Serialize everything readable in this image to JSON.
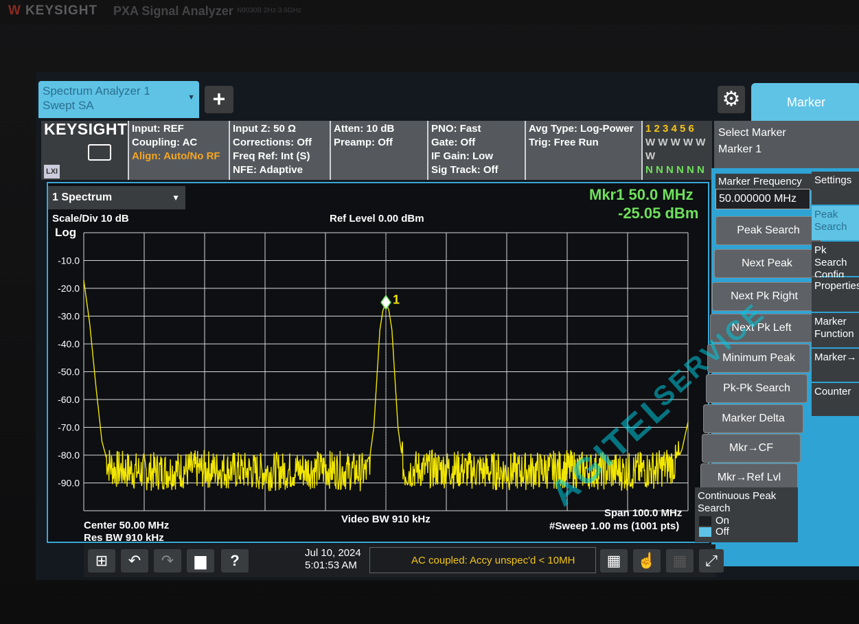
{
  "bezel": {
    "brand": "KEYSIGHT",
    "model": "PXA Signal Analyzer",
    "sub": "N9030B  2Hz-3.6GHz"
  },
  "tabs": {
    "active_line1": "Spectrum Analyzer 1",
    "active_line2": "Swept SA",
    "add": "+"
  },
  "right_tab": {
    "label": "Marker"
  },
  "info": {
    "brand": "KEYSIGHT",
    "lxi": "LXI",
    "col1": [
      "Input: REF",
      "Coupling: AC",
      "Align: Auto/No RF"
    ],
    "col2": [
      "Input Z: 50 Ω",
      "Corrections: Off",
      "Freq Ref: Int (S)",
      "NFE: Adaptive"
    ],
    "col3": [
      "Atten: 10 dB",
      "Preamp: Off"
    ],
    "col4": [
      "PNO: Fast",
      "Gate: Off",
      "IF Gain: Low",
      "Sig Track: Off"
    ],
    "col5": [
      "Avg Type: Log-Power",
      "Trig: Free Run"
    ],
    "trace_nums": "1 2 3 4 5 6",
    "trace_types": "W W W W W W",
    "trace_dets": "N N N N N N"
  },
  "select_marker": {
    "label": "Select Marker",
    "value": "Marker 1"
  },
  "window": {
    "spectrum_select": "1 Spectrum",
    "scale": "Scale/Div 10 dB",
    "log": "Log",
    "ref_level": "Ref Level 0.00 dBm",
    "mkr_freq": "Mkr1  50.0 MHz",
    "mkr_amp": "-25.05 dBm",
    "center": "Center 50.00 MHz",
    "res_bw": "Res BW 910 kHz",
    "video_bw": "Video BW 910 kHz",
    "span": "Span 100.0 MHz",
    "sweep": "#Sweep 1.00 ms (1001 pts)",
    "marker_label": "1"
  },
  "chart_data": {
    "type": "line",
    "xlabel": "",
    "ylabel": "",
    "xlim": [
      0,
      100
    ],
    "ylim": [
      -100,
      0
    ],
    "y_tick_labels": [
      "-10.0",
      "-20.0",
      "-30.0",
      "-40.0",
      "-50.0",
      "-60.0",
      "-70.0",
      "-80.0",
      "-90.0"
    ],
    "grid": true,
    "series": [
      {
        "color": "#f2e600",
        "x": [
          0,
          0.5,
          1,
          2,
          3,
          4,
          5,
          10,
          20,
          30,
          40,
          45,
          47,
          48,
          49,
          49.5,
          50,
          50.5,
          51,
          52,
          53,
          55,
          60,
          70,
          80,
          90,
          95,
          98,
          99,
          100
        ],
        "y": [
          -17,
          -25,
          -33,
          -55,
          -75,
          -83,
          -85,
          -86,
          -85,
          -86,
          -85,
          -86,
          -86,
          -70,
          -35,
          -28,
          -25,
          -28,
          -35,
          -70,
          -86,
          -85,
          -85,
          -86,
          -85,
          -86,
          -85,
          -83,
          -78,
          -68
        ]
      }
    ],
    "marker": {
      "x": 50,
      "y": -25.05
    }
  },
  "softkeys": {
    "marker_freq_label": "Marker Frequency",
    "marker_freq_value": "50.000000 MHz",
    "peak_search": "Peak Search",
    "next_peak": "Next Peak",
    "next_pk_right": "Next Pk Right",
    "next_pk_left": "Next Pk Left",
    "minimum_peak": "Minimum Peak",
    "pk_pk_search": "Pk-Pk Search",
    "marker_delta": "Marker Delta",
    "mkr_cf": "Mkr→CF",
    "mkr_ref": "Mkr→Ref Lvl",
    "cont_peak": "Continuous Peak Search",
    "on": "On",
    "off": "Off"
  },
  "side_tabs": [
    "Settings",
    "Peak Search",
    "Pk Search Config",
    "Properties",
    "Marker Function",
    "Marker→",
    "Counter"
  ],
  "taskbar": {
    "date": "Jul 10, 2024",
    "time": "5:01:53 AM",
    "message": "AC coupled: Accy unspec'd < 10MH"
  },
  "watermark": {
    "text1": "AGITEL",
    "text2": "SERVICE"
  }
}
